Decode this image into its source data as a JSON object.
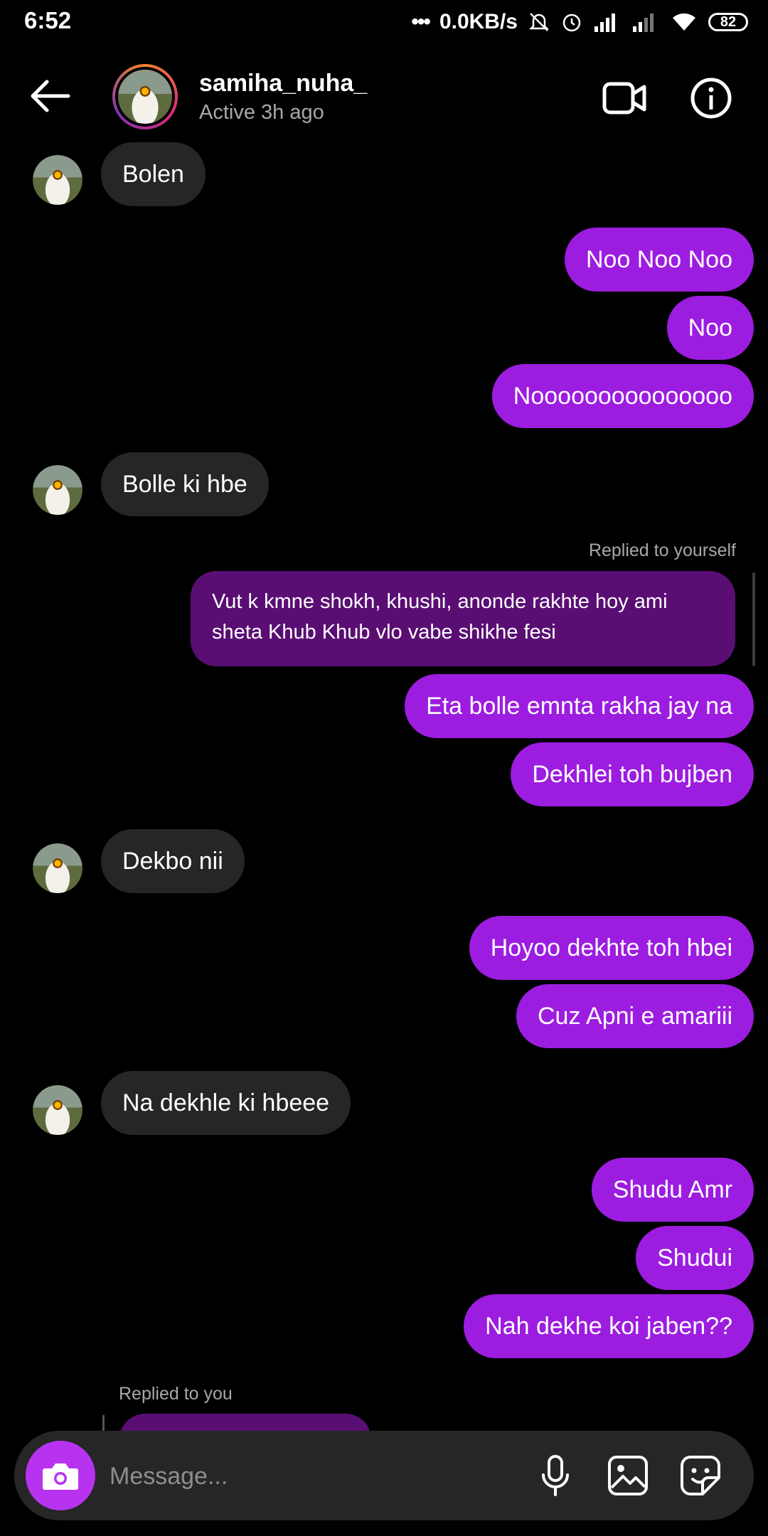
{
  "status_bar": {
    "time": "6:52",
    "net_speed": "0.0KB/s",
    "battery": "82"
  },
  "header": {
    "username": "samiha_nuha_",
    "status": "Active 3h ago"
  },
  "messages": {
    "m1": "Bolen",
    "m2": "Noo Noo Noo",
    "m3": "Noo",
    "m4": "Nooooooooooooooo",
    "m5": "Bolle ki hbe",
    "reply1_label": "Replied to yourself",
    "reply1_text": "Vut  k kmne shokh, khushi, anonde rakhte hoy ami sheta Khub Khub vlo vabe shikhe fesi",
    "m6": "Eta bolle emnta rakha jay na",
    "m7": "Dekhlei toh bujben",
    "m8": "Dekbo nii",
    "m9": "Hoyoo dekhte toh hbei",
    "m10": "Cuz Apni e amariii",
    "m11": "Na dekhle ki hbeee",
    "m12": "Shudu Amr",
    "m13": "Shudui",
    "m14": "Nah dekhe koi jaben??",
    "reply2_label": "Replied to you"
  },
  "composer": {
    "placeholder": "Message..."
  },
  "colors": {
    "outgoing": "#9c1de0",
    "incoming": "#262626",
    "reply": "#5a0e74",
    "camera": "#b833f0"
  }
}
